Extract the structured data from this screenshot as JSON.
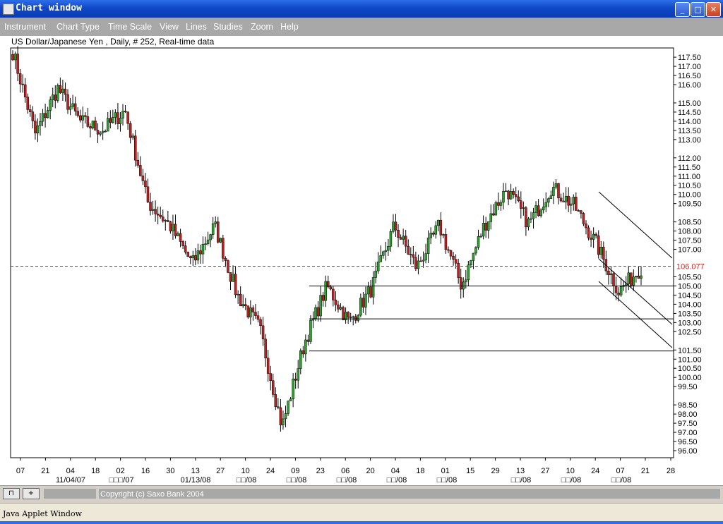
{
  "window": {
    "title": "Chart window",
    "minimize": "_",
    "maximize": "□",
    "close": "✕"
  },
  "menu": [
    "Instrument",
    "Chart Type",
    "Time Scale",
    "View",
    "Lines",
    "Studies",
    "Zoom",
    "Help"
  ],
  "chart_header": "US Dollar/Japanese Yen , Daily, # 252, Real-time data",
  "chart_data": {
    "type": "candlestick",
    "yaxis_labels": [
      "117.50",
      "117.00",
      "116.50",
      "116.00",
      "115.00",
      "114.50",
      "114.00",
      "113.50",
      "113.00",
      "112.00",
      "111.50",
      "111.00",
      "110.50",
      "110.00",
      "109.50",
      "108.50",
      "108.00",
      "107.50",
      "107.00",
      "105.50",
      "105.00",
      "104.50",
      "104.00",
      "103.50",
      "103.00",
      "102.50",
      "101.50",
      "101.00",
      "100.50",
      "100.00",
      "99.50",
      "98.50",
      "98.00",
      "97.50",
      "97.00",
      "96.50",
      "96.00"
    ],
    "current_price_label": "106.077",
    "current_price": 106.077,
    "xaxis_days": [
      "07",
      "21",
      "04",
      "18",
      "02",
      "16",
      "30",
      "13",
      "27",
      "10",
      "24",
      "09",
      "23",
      "06",
      "20",
      "04",
      "18",
      "01",
      "15",
      "29",
      "13",
      "27",
      "10",
      "24",
      "07",
      "21",
      "28"
    ],
    "xaxis_months": [
      "11/04/07",
      "□□□/07",
      "01/13/08",
      "□□/08",
      "□□/08",
      "□□/08",
      "□□/08",
      "□□/08",
      "□□/08",
      "□□/08",
      "□□/08"
    ],
    "key_prices": [
      117.8,
      113.3,
      115.8,
      114.0,
      113.5,
      114.6,
      109.6,
      108.3,
      106.2,
      108.3,
      104.5,
      102.7,
      97.3,
      101.9,
      105.0,
      103.0,
      104.9,
      108.3,
      106.0,
      108.3,
      105.0,
      108.3,
      110.3,
      108.4,
      110.4,
      109.4,
      107.3,
      104.7,
      106.0
    ],
    "horizontal_lines": [
      105.0,
      103.2,
      101.45
    ],
    "colors": {
      "up": "#2ea32e",
      "down": "#c02020",
      "current_line": "#e02020"
    }
  },
  "statusbar": {
    "copyright": "Copyright (c) Saxo Bank 2004",
    "btn1": "⊓",
    "btn2": "+"
  },
  "applet": "Java Applet Window"
}
